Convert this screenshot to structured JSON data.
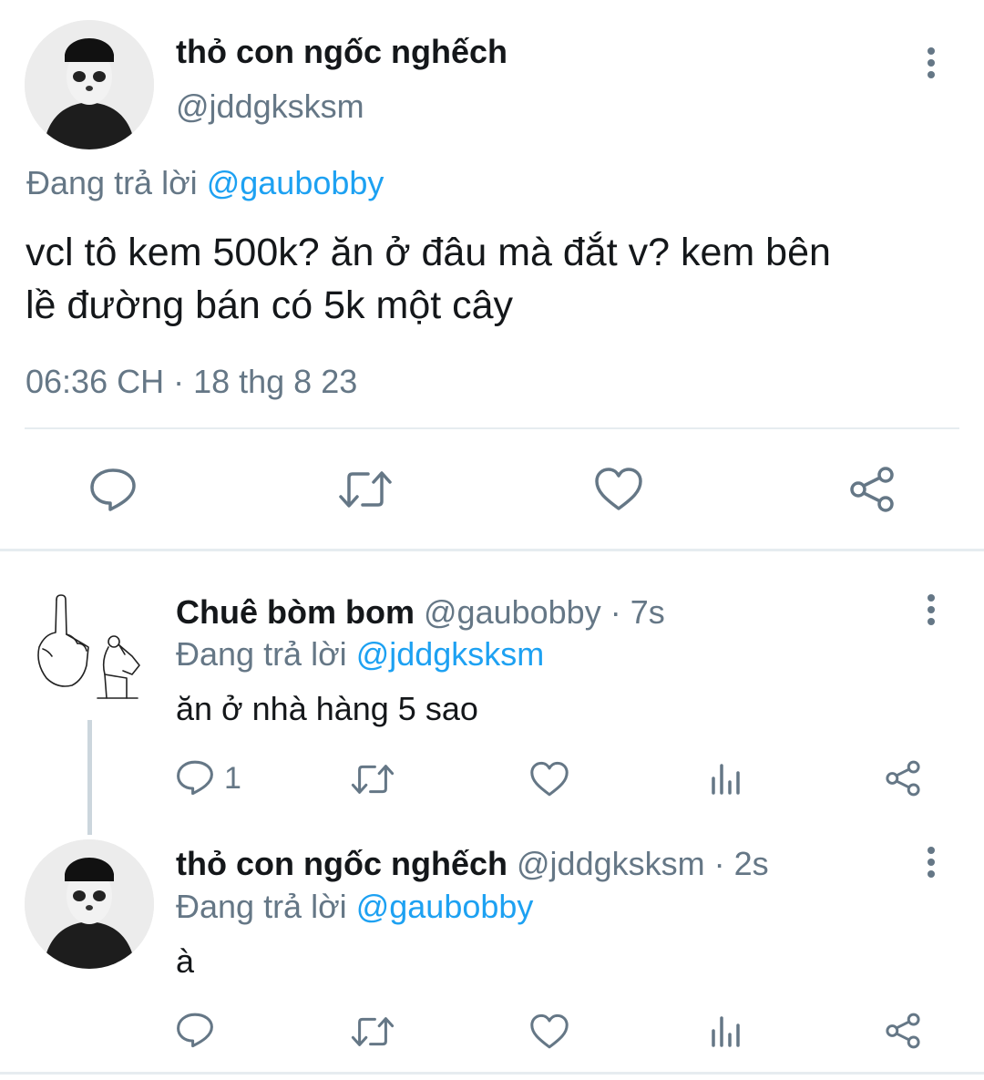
{
  "main_tweet": {
    "author_name": "thỏ con ngốc nghếch",
    "author_handle": "@jddgksksm",
    "reply_prefix": "Đang trả lời",
    "reply_to": "@gaubobby",
    "text_line1": "vcl tô kem 500k? ăn ở đâu mà đắt v? kem bên",
    "text_line2": "lề đường bán có 5k một cây",
    "timestamp": "06:36 CH · 18 thg 8 23",
    "actions": [
      "reply-icon",
      "retweet-icon",
      "like-icon",
      "share-icon"
    ]
  },
  "replies": [
    {
      "author_name": "Chuê bòm bom",
      "author_handle": "@gaubobby",
      "time": " · 7s",
      "reply_prefix": "Đang trả lời",
      "reply_to": "@jddgksksm",
      "text": "ăn ở nhà hàng 5 sao",
      "reply_count": "1"
    },
    {
      "author_name": "thỏ con ngốc nghếch",
      "author_handle": "@jddgksksm",
      "time": " · 2s",
      "reply_prefix": "Đang trả lời",
      "reply_to": "@gaubobby",
      "text": "à",
      "reply_count": ""
    }
  ],
  "colors": {
    "text": "#14171a",
    "secondary": "#657786",
    "link": "#1da1f2",
    "divider": "#e6ecf0"
  }
}
